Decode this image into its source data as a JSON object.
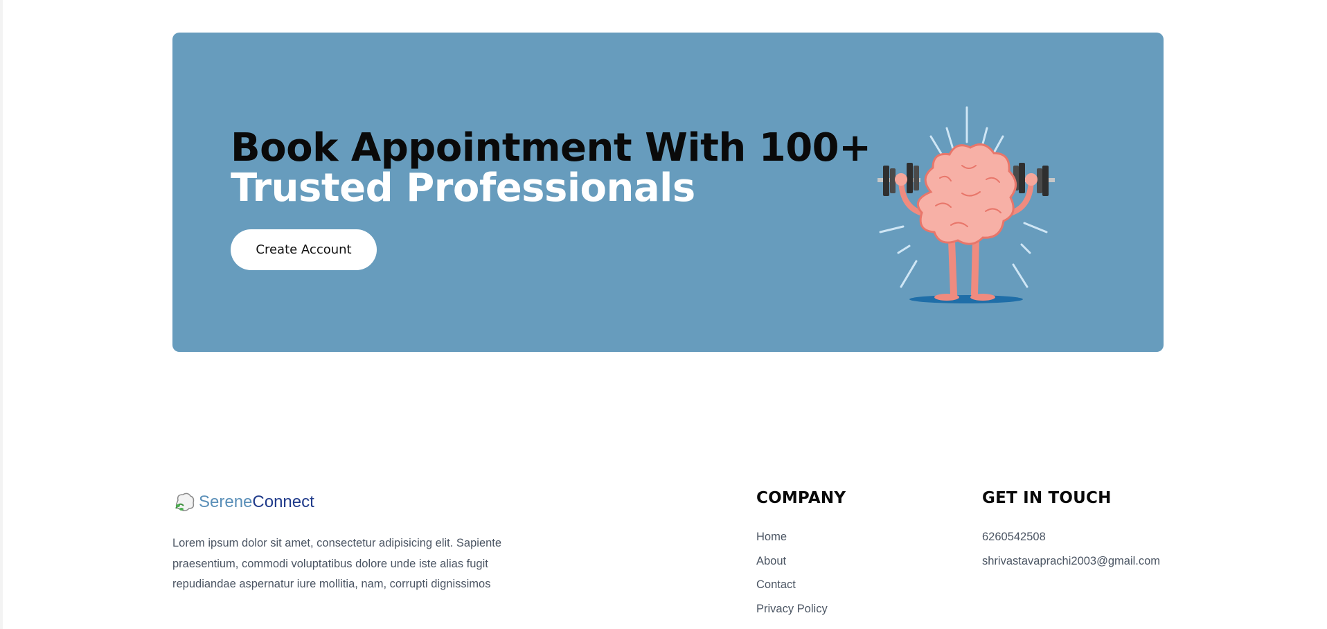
{
  "banner": {
    "heading_line1": "Book Appointment With 100+",
    "heading_line2": "Trusted Professionals",
    "cta_label": "Create Account",
    "background_color": "#679cbd",
    "illustration_icon": "brain-lifting-dumbbells-icon"
  },
  "footer": {
    "brand_part1": "Serene",
    "brand_part2": "Connect",
    "logo_icon": "brain-leaf-logo-icon",
    "description": "Lorem ipsum dolor sit amet, consectetur adipisicing elit. Sapiente praesentium, commodi voluptatibus dolore unde iste alias fugit repudiandae aspernatur iure mollitia, nam, corrupti dignissimos",
    "company": {
      "title": "COMPANY",
      "links": [
        "Home",
        "About",
        "Contact",
        "Privacy Policy"
      ]
    },
    "contact": {
      "title": "GET IN TOUCH",
      "phone": "6260542508",
      "email": "shrivastavaprachi2003@gmail.com"
    }
  }
}
